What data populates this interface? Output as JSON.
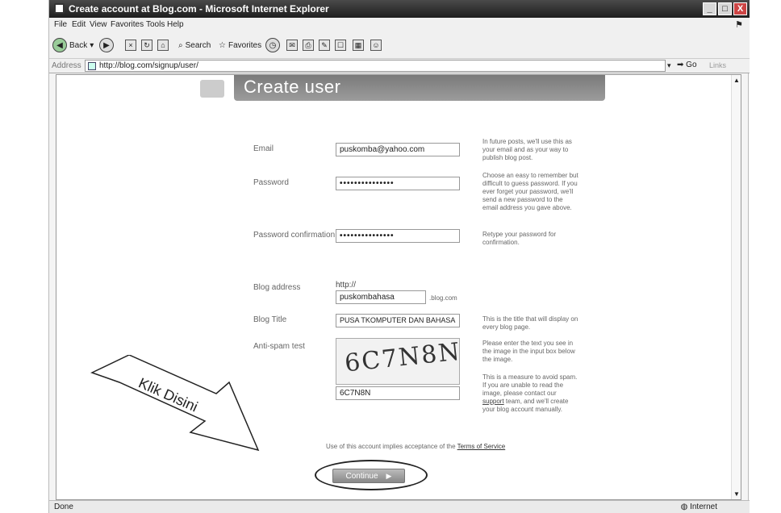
{
  "window": {
    "title": "Create account at Blog.com - Microsoft Internet Explorer",
    "controls": [
      "_",
      "□",
      "X"
    ]
  },
  "menubar": [
    "File",
    "Edit",
    "View",
    "Favorites",
    "Tools",
    "Help"
  ],
  "toolbar": {
    "back_label": "Back",
    "search_label": "Search",
    "favorites_label": "Favorites"
  },
  "addressbar": {
    "label": "Address",
    "url": "http://blog.com/signup/user/",
    "go_label": "Go",
    "links_label": "Links"
  },
  "page": {
    "header_title": "Create user",
    "fields": {
      "email_label": "Email",
      "email_value": "puskomba@yahoo.com",
      "password_label": "Password",
      "password_value": "•••••••••••••••",
      "password_confirm_label": "Password confirmation",
      "password_confirm_value": "•••••••••••••••",
      "blog_address_label": "Blog address",
      "blog_address_prefix": "http://",
      "blog_address_value": "puskombahasa",
      "blog_address_suffix": ".blog.com",
      "blog_title_label": "Blog Title",
      "blog_title_value": "PUSA TKOMPUTER DAN BAHASA",
      "anti_spam_label": "Anti-spam test",
      "captcha_text": "6C7N8N",
      "captcha_value": "6C7N8N"
    },
    "hints": {
      "email": "In future posts, we'll use this as your email and as your way to publish blog post.",
      "password": "Choose an easy to remember but difficult to guess password. If you ever forget your password, we'll send a new password to the email address you gave above.",
      "password_confirm": "Retype your password for confirmation.",
      "blog_title": "This is the title that will display on every blog page.",
      "captcha_1": "Please enter the text you see in the image in the input box below the image.",
      "captcha_2_pre": "This is a measure to avoid spam. If you are unable to read the image, please contact our ",
      "captcha_2_link": "support",
      "captcha_2_post": " team, and we'll create your blog account manually."
    },
    "terms_prefix": "Use of this account implies acceptance of the ",
    "terms_link": "Terms of Service",
    "continue_label": "Continue",
    "callout_text": "Klik Disini"
  },
  "statusbar": {
    "status": "Done",
    "zone": "Internet"
  }
}
